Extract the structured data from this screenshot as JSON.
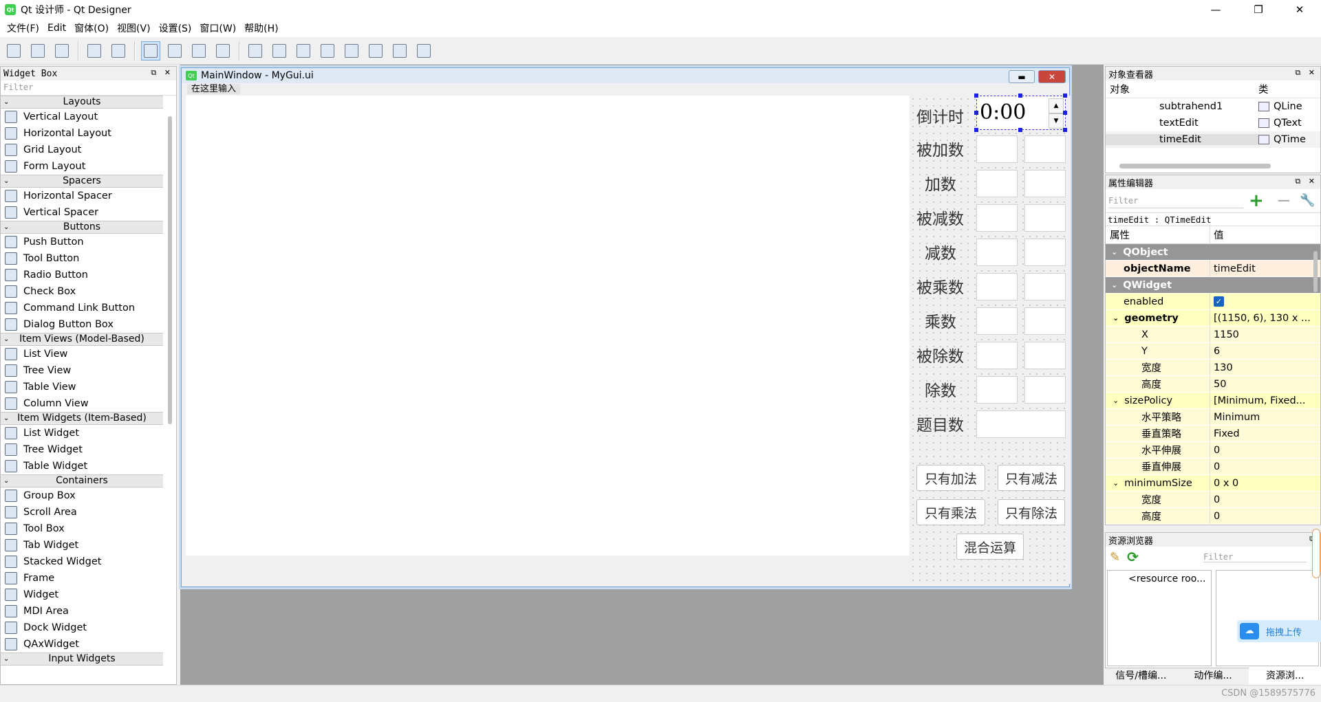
{
  "window": {
    "title": "Qt 设计师 - Qt Designer",
    "app_icon": "Qt",
    "minimize": "—",
    "maximize": "❐",
    "close": "✕"
  },
  "menu": [
    "文件(F)",
    "Edit",
    "窗体(O)",
    "视图(V)",
    "设置(S)",
    "窗口(W)",
    "帮助(H)"
  ],
  "toolbar_icons": [
    "new-file-icon",
    "open-file-icon",
    "save-icon",
    "send-to-back-icon",
    "bring-to-front-icon",
    "edit-widgets-icon",
    "edit-signals-slots-icon",
    "edit-buddies-icon",
    "edit-tab-order-icon",
    "layout-horizontal-icon",
    "layout-vertical-icon",
    "layout-h-splitter-icon",
    "layout-v-splitter-icon",
    "layout-grid-icon",
    "layout-form-icon",
    "break-layout-icon",
    "adjust-size-icon"
  ],
  "widget_box": {
    "title": "Widget Box",
    "filter_placeholder": "Filter",
    "categories": [
      {
        "name": "Layouts",
        "items": [
          "Vertical Layout",
          "Horizontal Layout",
          "Grid Layout",
          "Form Layout"
        ]
      },
      {
        "name": "Spacers",
        "items": [
          "Horizontal Spacer",
          "Vertical Spacer"
        ]
      },
      {
        "name": "Buttons",
        "items": [
          "Push Button",
          "Tool Button",
          "Radio Button",
          "Check Box",
          "Command Link Button",
          "Dialog Button Box"
        ]
      },
      {
        "name": "Item Views (Model-Based)",
        "items": [
          "List View",
          "Tree View",
          "Table View",
          "Column View"
        ]
      },
      {
        "name": "Item Widgets (Item-Based)",
        "items": [
          "List Widget",
          "Tree Widget",
          "Table Widget"
        ]
      },
      {
        "name": "Containers",
        "items": [
          "Group Box",
          "Scroll Area",
          "Tool Box",
          "Tab Widget",
          "Stacked Widget",
          "Frame",
          "Widget",
          "MDI Area",
          "Dock Widget",
          "QAxWidget"
        ]
      },
      {
        "name": "Input Widgets",
        "items": []
      }
    ]
  },
  "form_window": {
    "title": "MainWindow - MyGui.ui",
    "menu_placeholder": "在这里输入",
    "time_label": "倒计时",
    "time_value": "0:00",
    "labels": [
      "被加数",
      "加数",
      "被减数",
      "减数",
      "被乘数",
      "乘数",
      "被除数",
      "除数",
      "题目数"
    ],
    "buttons": [
      "只有加法",
      "只有减法",
      "只有乘法",
      "只有除法",
      "混合运算"
    ]
  },
  "object_inspector": {
    "title": "对象查看器",
    "col_object": "对象",
    "col_class": "类",
    "rows": [
      {
        "name": "subtrahend1",
        "class": "QLine"
      },
      {
        "name": "textEdit",
        "class": "QText"
      },
      {
        "name": "timeEdit",
        "class": "QTime"
      }
    ]
  },
  "property_editor": {
    "title": "属性编辑器",
    "filter_placeholder": "Filter",
    "object_label": "timeEdit : QTimeEdit",
    "col_property": "属性",
    "col_value": "值",
    "rows": [
      {
        "name": "QObject",
        "value": "",
        "type": "group"
      },
      {
        "name": "objectName",
        "value": "timeEdit",
        "type": "sel"
      },
      {
        "name": "QWidget",
        "value": "",
        "type": "group"
      },
      {
        "name": "enabled",
        "value": "✓",
        "type": "yel"
      },
      {
        "name": "geometry",
        "value": "[(1150, 6), 130 x ...",
        "type": "yel"
      },
      {
        "name": "X",
        "value": "1150",
        "type": "yel2"
      },
      {
        "name": "Y",
        "value": "6",
        "type": "yel2"
      },
      {
        "name": "宽度",
        "value": "130",
        "type": "yel2"
      },
      {
        "name": "高度",
        "value": "50",
        "type": "yel2"
      },
      {
        "name": "sizePolicy",
        "value": "[Minimum, Fixed...",
        "type": "yel"
      },
      {
        "name": "水平策略",
        "value": "Minimum",
        "type": "yel2"
      },
      {
        "name": "垂直策略",
        "value": "Fixed",
        "type": "yel2"
      },
      {
        "name": "水平伸展",
        "value": "0",
        "type": "yel2"
      },
      {
        "name": "垂直伸展",
        "value": "0",
        "type": "yel2"
      },
      {
        "name": "minimumSize",
        "value": "0 x 0",
        "type": "yel"
      },
      {
        "name": "宽度",
        "value": "0",
        "type": "yel2"
      },
      {
        "name": "高度",
        "value": "0",
        "type": "yel2"
      }
    ]
  },
  "resource_browser": {
    "title": "资源浏览器",
    "filter_placeholder": "Filter",
    "root_item": "<resource roo...",
    "upload_badge": "拖拽上传"
  },
  "bottom_tabs": [
    "信号/槽编...",
    "动作编...",
    "资源浏..."
  ],
  "watermark": "CSDN @1589575776",
  "colors": {
    "accent": "#1e1ee0",
    "group_header": "#969696",
    "changed_property": "#ffffc0",
    "selected_property": "#fdeede",
    "qt_green": "#41cd52"
  }
}
